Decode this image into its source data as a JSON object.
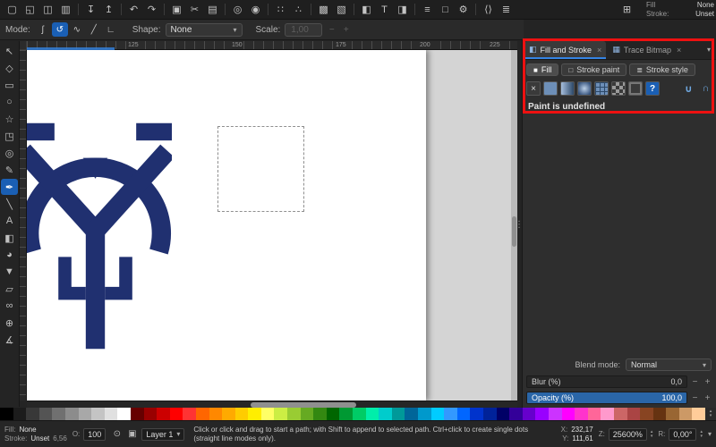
{
  "theme": {
    "accent": "#3584e4",
    "logo_color": "#203070",
    "annotation_red": "#ee1111"
  },
  "glyphs": {
    "chevron_down": "▾",
    "spin_up": "▴",
    "spin_down": "▾",
    "minus": "−",
    "plus": "+",
    "close": "×",
    "dots": "⋮",
    "scroll_up": "▴",
    "scroll_down": "▾"
  },
  "command_bar": {
    "items": [
      {
        "name": "new-document-icon",
        "glyph": "▢"
      },
      {
        "name": "open-icon",
        "glyph": "◱"
      },
      {
        "name": "save-icon",
        "glyph": "◫"
      },
      {
        "name": "print-icon",
        "glyph": "▥"
      },
      {
        "sep": true
      },
      {
        "name": "import-icon",
        "glyph": "↧"
      },
      {
        "name": "export-icon",
        "glyph": "↥"
      },
      {
        "sep": true
      },
      {
        "name": "undo-icon",
        "glyph": "↶"
      },
      {
        "name": "redo-icon",
        "glyph": "↷"
      },
      {
        "sep": true
      },
      {
        "name": "copy-icon",
        "glyph": "▣"
      },
      {
        "name": "cut-icon",
        "glyph": "✂"
      },
      {
        "name": "paste-icon",
        "glyph": "▤"
      },
      {
        "sep": true
      },
      {
        "name": "zoom-page-icon",
        "glyph": "◎"
      },
      {
        "name": "zoom-drawing-icon",
        "glyph": "◉"
      },
      {
        "sep": true
      },
      {
        "name": "duplicate-icon",
        "glyph": "∷"
      },
      {
        "name": "clone-icon",
        "glyph": "∴"
      },
      {
        "sep": true
      },
      {
        "name": "group-icon",
        "glyph": "▩"
      },
      {
        "name": "ungroup-icon",
        "glyph": "▧"
      },
      {
        "sep": true
      },
      {
        "name": "fill-stroke-dialog-icon",
        "glyph": "◧"
      },
      {
        "name": "text-dialog-icon",
        "glyph": "T"
      },
      {
        "name": "gradient-dialog-icon",
        "glyph": "◨"
      },
      {
        "sep": true
      },
      {
        "name": "align-dialog-icon",
        "glyph": "≡"
      },
      {
        "name": "document-properties-icon",
        "glyph": "□"
      },
      {
        "name": "preferences-icon",
        "glyph": "⚙"
      },
      {
        "sep": true
      },
      {
        "name": "xml-editor-icon",
        "glyph": "⟨⟩"
      },
      {
        "name": "layers-dialog-icon",
        "glyph": "≣"
      },
      {
        "name": "snap-toggle-icon",
        "glyph": "⊞",
        "right": true
      }
    ]
  },
  "tool_controls": {
    "mode_label": "Mode:",
    "modes": [
      {
        "name": "mode-bezier-button",
        "glyph": "ʃ",
        "active": false
      },
      {
        "name": "mode-spiro-button",
        "glyph": "↺",
        "active": true
      },
      {
        "name": "mode-bspline-button",
        "glyph": "∿",
        "active": false
      },
      {
        "name": "mode-straight-lines-button",
        "glyph": "╱",
        "active": false
      },
      {
        "name": "mode-paraxial-button",
        "glyph": "∟",
        "active": false
      }
    ],
    "shape_label": "Shape:",
    "shape_value": "None",
    "scale_label": "Scale:",
    "scale_value": "1,00"
  },
  "style_indicator": {
    "fill_label": "Fill",
    "fill_value": "None",
    "stroke_label": "Stroke:",
    "stroke_value": "Unset"
  },
  "ruler": {
    "labels": [
      {
        "text": "125",
        "offset": 112
      },
      {
        "text": "150",
        "offset": 228
      },
      {
        "text": "175",
        "offset": 344
      },
      {
        "text": "200",
        "offset": 438
      },
      {
        "text": "225",
        "offset": 516
      }
    ]
  },
  "toolbox": {
    "tools": [
      {
        "name": "tool-selector",
        "glyph": "↖"
      },
      {
        "name": "tool-node-editor",
        "glyph": "◇"
      },
      {
        "name": "tool-rectangle",
        "glyph": "▭"
      },
      {
        "name": "tool-ellipse",
        "glyph": "○"
      },
      {
        "name": "tool-star",
        "glyph": "☆"
      },
      {
        "name": "tool-3dbox",
        "glyph": "◳"
      },
      {
        "name": "tool-spiral",
        "glyph": "◎"
      },
      {
        "name": "tool-pencil",
        "glyph": "✎"
      },
      {
        "name": "tool-pen",
        "glyph": "✒",
        "active": true
      },
      {
        "name": "tool-calligraphy",
        "glyph": "╲"
      },
      {
        "name": "tool-text",
        "glyph": "A"
      },
      {
        "name": "tool-gradient",
        "glyph": "◧"
      },
      {
        "name": "tool-dropper",
        "glyph": "◕"
      },
      {
        "name": "tool-paint-bucket",
        "glyph": "▼"
      },
      {
        "name": "tool-eraser",
        "glyph": "▱"
      },
      {
        "name": "tool-connector",
        "glyph": "∞"
      },
      {
        "name": "tool-zoom",
        "glyph": "⊕"
      },
      {
        "name": "tool-measure",
        "glyph": "∡"
      }
    ]
  },
  "dock": {
    "tabs": [
      {
        "name": "tab-fill-and-stroke",
        "icon_glyph": "◧",
        "label": "Fill and Stroke",
        "active": true
      },
      {
        "name": "tab-trace-bitmap",
        "icon_glyph": "▦",
        "label": "Trace Bitmap",
        "active": false
      }
    ],
    "fill_stroke": {
      "subtabs": [
        {
          "name": "subtab-fill",
          "icon_glyph": "■",
          "label": "Fill",
          "active": true
        },
        {
          "name": "subtab-stroke-paint",
          "icon_glyph": "□",
          "label": "Stroke paint",
          "active": false
        },
        {
          "name": "subtab-stroke-style",
          "icon_glyph": "≣",
          "label": "Stroke style",
          "active": false
        }
      ],
      "paint_types": [
        {
          "name": "paint-no-paint-button",
          "kind": "none",
          "glyph": "×"
        },
        {
          "name": "paint-flat-color-button",
          "kind": "flat"
        },
        {
          "name": "paint-linear-gradient-button",
          "kind": "linear"
        },
        {
          "name": "paint-radial-gradient-button",
          "kind": "radial"
        },
        {
          "name": "paint-mesh-gradient-button",
          "kind": "mesh"
        },
        {
          "name": "paint-pattern-button",
          "kind": "pattern"
        },
        {
          "name": "paint-swatch-button",
          "kind": "swatch"
        },
        {
          "name": "paint-unknown-button",
          "kind": "unknown",
          "glyph": "?"
        }
      ],
      "fill_rules": [
        {
          "name": "fill-rule-evenodd-button",
          "glyph": "∪"
        },
        {
          "name": "fill-rule-nonzero-button",
          "glyph": "∩"
        }
      ],
      "message": "Paint is undefined",
      "blend_label": "Blend mode:",
      "blend_value": "Normal",
      "blur_label": "Blur (%)",
      "blur_value": "0,0",
      "opacity_label": "Opacity (%)",
      "opacity_value": "100,0"
    }
  },
  "palette": {
    "colors": [
      "#000000",
      "#1c1c1c",
      "#383838",
      "#545454",
      "#707070",
      "#8c8c8c",
      "#a8a8a8",
      "#c4c4c4",
      "#e0e0e0",
      "#ffffff",
      "#660000",
      "#990000",
      "#cc0000",
      "#ff0000",
      "#ff3333",
      "#ff6600",
      "#ff8800",
      "#ffaa00",
      "#ffcc00",
      "#ffee00",
      "#ffff66",
      "#ccee44",
      "#99cc33",
      "#66aa22",
      "#338811",
      "#006600",
      "#009933",
      "#00cc66",
      "#00eeaa",
      "#00cccc",
      "#009999",
      "#006699",
      "#0099cc",
      "#00ccff",
      "#3399ff",
      "#0066ff",
      "#0033cc",
      "#002299",
      "#000066",
      "#330099",
      "#6600cc",
      "#9900ff",
      "#cc33ff",
      "#ff00ff",
      "#ff33cc",
      "#ff6699",
      "#ff99cc",
      "#cc6666",
      "#aa4444",
      "#884422",
      "#663311",
      "#996633",
      "#cc9966",
      "#ffcc99"
    ]
  },
  "status_bar": {
    "fill_label": "Fill:",
    "fill_value": "None",
    "stroke_label": "Stroke:",
    "stroke_value": "Unset",
    "stroke_width": "6,56",
    "opacity_label": "O:",
    "opacity_value": "100",
    "layer_visibility_icon": "⊙",
    "layer_lock_icon": "▣",
    "layer_name": "Layer 1",
    "message_line1": "Click or click and drag to start a path; with Shift to append to selected path. Ctrl+click to create single dots",
    "message_line2": "(straight line modes only).",
    "x_label": "X:",
    "x_value": "232,17",
    "y_label": "Y:",
    "y_value": "111,61",
    "z_label": "Z:",
    "z_value": "25600%",
    "r_label": "R:",
    "r_value": "0,00°"
  }
}
